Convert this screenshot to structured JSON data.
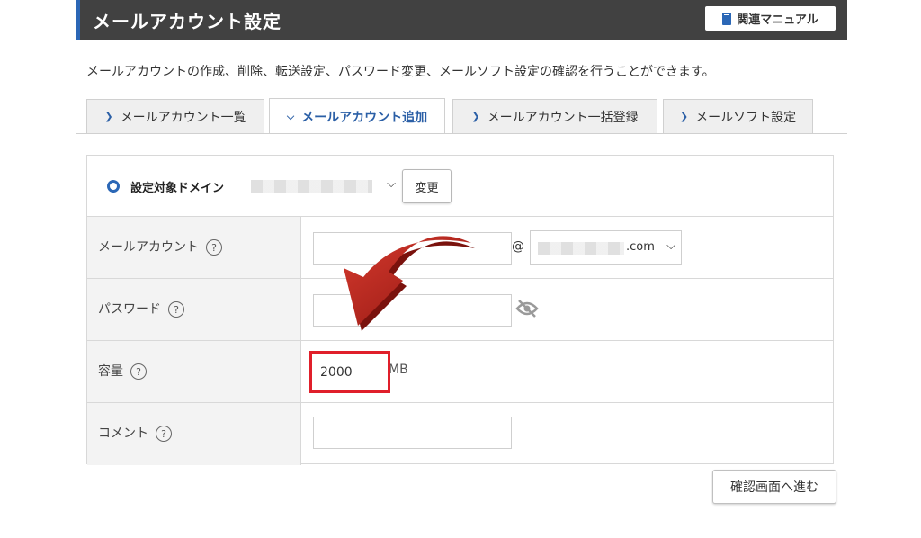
{
  "header": {
    "title": "メールアカウント設定",
    "manual_label": "関連マニュアル"
  },
  "description": "メールアカウントの作成、削除、転送設定、パスワード変更、メールソフト設定の確認を行うことができます。",
  "tabs": [
    {
      "label": "メールアカウント一覧",
      "active": false
    },
    {
      "label": "メールアカウント追加",
      "active": true
    },
    {
      "label": "メールアカウント一括登録",
      "active": false
    },
    {
      "label": "メールソフト設定",
      "active": false
    }
  ],
  "domain": {
    "label": "設定対象ドメイン",
    "change_label": "変更"
  },
  "form": {
    "account_label": "メールアカウント",
    "at": "@",
    "domain_suffix": ".com",
    "password_label": "パスワード",
    "quota_label": "容量",
    "quota_value": "2000",
    "quota_unit": "MB",
    "comment_label": "コメント",
    "help": "?"
  },
  "confirm_label": "確認画面へ進む",
  "colors": {
    "accent": "#2b67b6",
    "highlight": "#e01f2a",
    "arrow": "#c0241d"
  }
}
